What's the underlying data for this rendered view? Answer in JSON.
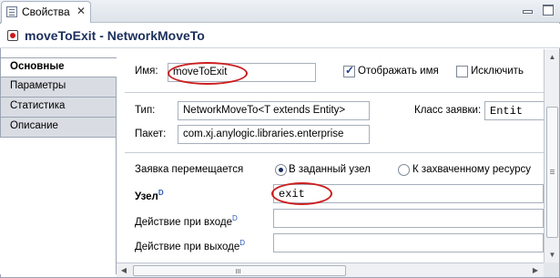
{
  "tab": {
    "label": "Свойства",
    "close": "✕"
  },
  "title": "moveToExit - NetworkMoveTo",
  "sidebar": {
    "items": [
      {
        "label": "Основные",
        "active": true
      },
      {
        "label": "Параметры"
      },
      {
        "label": "Статистика"
      },
      {
        "label": "Описание"
      }
    ]
  },
  "general": {
    "name_label": "Имя:",
    "name_value": "moveToExit",
    "show_name_label": "Отображать имя",
    "show_name_checked": true,
    "exclude_label": "Исключить",
    "exclude_checked": false
  },
  "type": {
    "type_label": "Тип:",
    "type_value": "NetworkMoveTo<T extends Entity>",
    "entity_class_label": "Класс заявки:",
    "entity_class_value": "Entit",
    "package_label": "Пакет:",
    "package_value": "com.xj.anylogic.libraries.enterprise"
  },
  "params": {
    "moves_label": "Заявка перемещается",
    "option_node": "В заданный узел",
    "option_resource": "К захваченному ресурсу",
    "selected": "option_node",
    "node_label": "Узел",
    "node_sup": "D",
    "node_value": "exit",
    "on_enter_label": "Действие при входе",
    "on_enter_sup": "D",
    "on_enter_value": "",
    "on_exit_label": "Действие при выходе",
    "on_exit_sup": "D",
    "on_exit_value": ""
  },
  "colors": {
    "highlight_oval": "#cc1f1f",
    "title_text": "#1b2f5b"
  },
  "icons": [
    "properties-icon",
    "close-icon",
    "minimize-icon",
    "maximize-icon",
    "block-icon"
  ]
}
